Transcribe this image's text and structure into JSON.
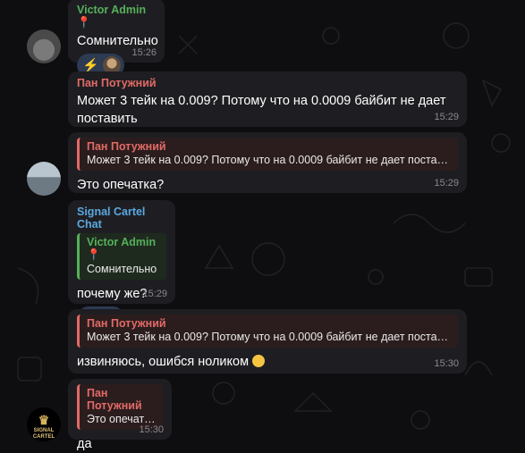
{
  "messages": [
    {
      "sender": "Victor Admin 📍",
      "text": "Сомнительно",
      "reactions": [
        "⚡"
      ],
      "time": "15:26"
    },
    {
      "sender": "Пан Потужний",
      "text": "Может 3 тейк на 0.009? Потому что на 0.0009 байбит не дает поставить",
      "time": "15:29"
    },
    {
      "quote_sender": "Пан Потужний",
      "quote_text": "Может 3 тейк на 0.009? Потому что на 0.0009 байбит не дает поста…",
      "text": "Это опечатка?",
      "time": "15:29"
    },
    {
      "sender": "Signal Cartel Chat",
      "quote_sender": "Victor Admin 📍",
      "quote_text": "Сомнительно",
      "text": "почему же?",
      "reactions": [
        "😱"
      ],
      "time": "15:29"
    },
    {
      "quote_sender": "Пан Потужний",
      "quote_text": "Может 3 тейк на 0.009? Потому что на 0.0009 байбит не дает поста…",
      "text": "извиняюсь, ошибся ноликом",
      "time": "15:30"
    },
    {
      "quote_sender": "Пан Потужний",
      "quote_text": "Это опечатка?",
      "text": "да",
      "time": "15:30"
    }
  ],
  "avatars": {
    "signal_cartel_label_1": "SIGNAL",
    "signal_cartel_label_2": "CARTEL"
  },
  "colors": {
    "background": "#0e0e10",
    "bubble": "#1e1e22",
    "sender_green": "#56b05a",
    "sender_red": "#e26a66",
    "sender_blue": "#5ba8e0",
    "reaction_bg": "#2c3a52"
  }
}
